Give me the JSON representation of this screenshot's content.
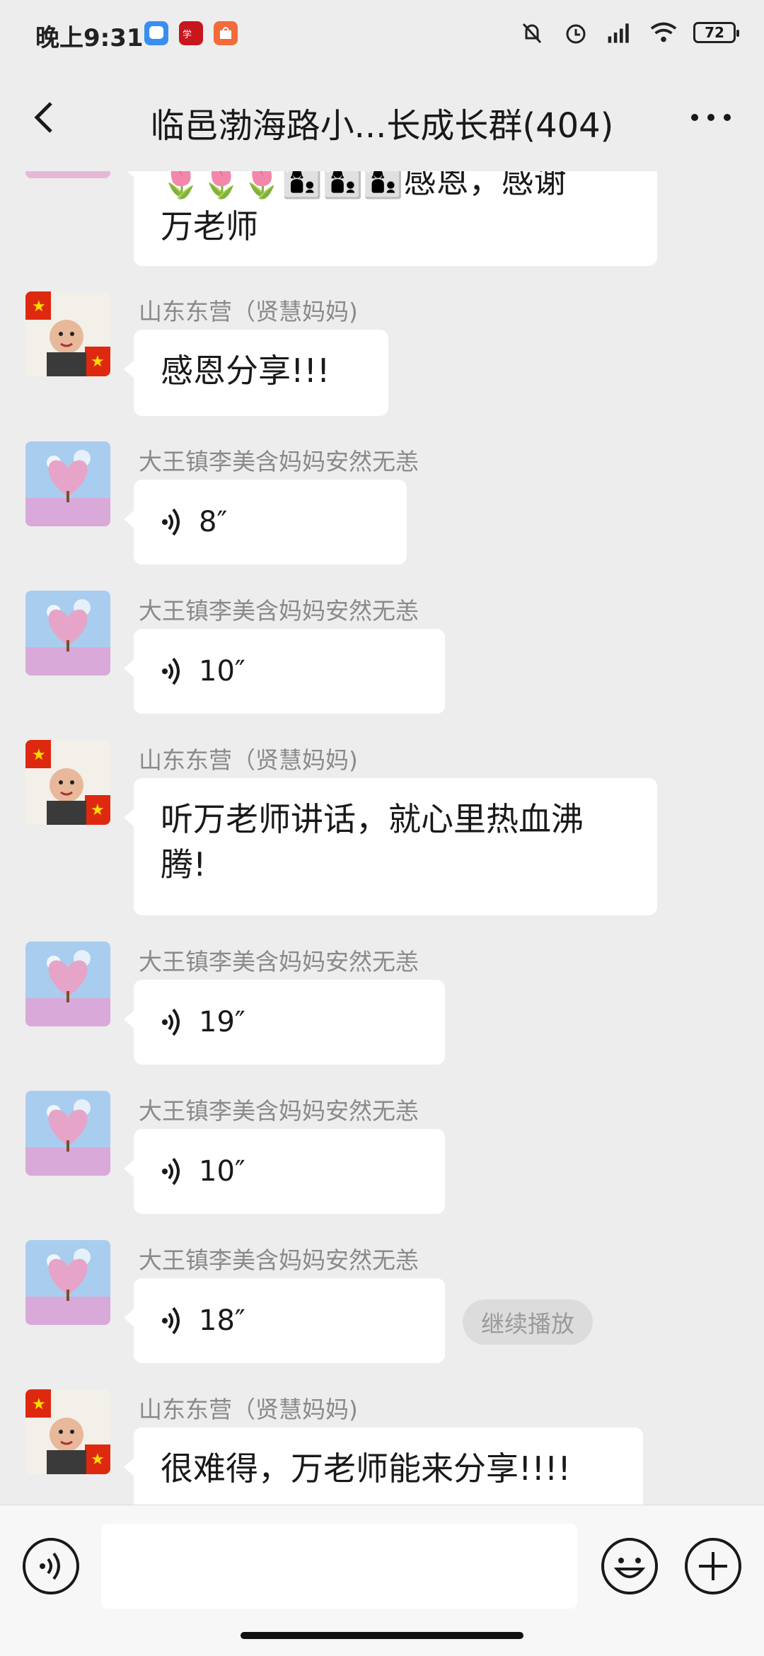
{
  "status_bar": {
    "time": "晚上9:31",
    "battery": "72",
    "icons": [
      "chat-app-icon",
      "study-app-icon",
      "store-app-icon",
      "mute-icon",
      "alarm-icon",
      "signal-icon",
      "wifi-icon",
      "battery-icon"
    ]
  },
  "nav": {
    "title": "临邑渤海路小...长成长群(404)",
    "back_icon": "back-arrow-icon",
    "more_icon": "more-dots-icon"
  },
  "messages": [
    {
      "type": "text",
      "sender": "",
      "text_line1": "🌷🌷🌷👩‍👦👩‍👦👩‍👦感恩，感谢",
      "text_line2": "万老师"
    },
    {
      "type": "text",
      "sender": "山东东营（贤慧妈妈)",
      "text": "感恩分享!!!"
    },
    {
      "type": "voice",
      "sender": "大王镇李美含妈妈安然无恙",
      "duration": "8″"
    },
    {
      "type": "voice",
      "sender": "大王镇李美含妈妈安然无恙",
      "duration": "10″"
    },
    {
      "type": "text",
      "sender": "山东东营（贤慧妈妈)",
      "text_line1": "听万老师讲话，就心里热血沸",
      "text_line2": "腾!"
    },
    {
      "type": "voice",
      "sender": "大王镇李美含妈妈安然无恙",
      "duration": "19″"
    },
    {
      "type": "voice",
      "sender": "大王镇李美含妈妈安然无恙",
      "duration": "10″"
    },
    {
      "type": "voice",
      "sender": "大王镇李美含妈妈安然无恙",
      "duration": "18″",
      "badge": "继续播放"
    },
    {
      "type": "text",
      "sender": "山东东营（贤慧妈妈)",
      "text": "很难得，万老师能来分享!!!!"
    }
  ],
  "input_bar": {
    "voice_icon": "voice-input-icon",
    "emoji_icon": "emoji-icon",
    "plus_icon": "plus-icon",
    "text_value": ""
  },
  "colors": {
    "background": "#ededed",
    "bubble": "#ffffff",
    "sender_text": "#8a8a8a",
    "badge_bg": "#dcdcdc"
  }
}
